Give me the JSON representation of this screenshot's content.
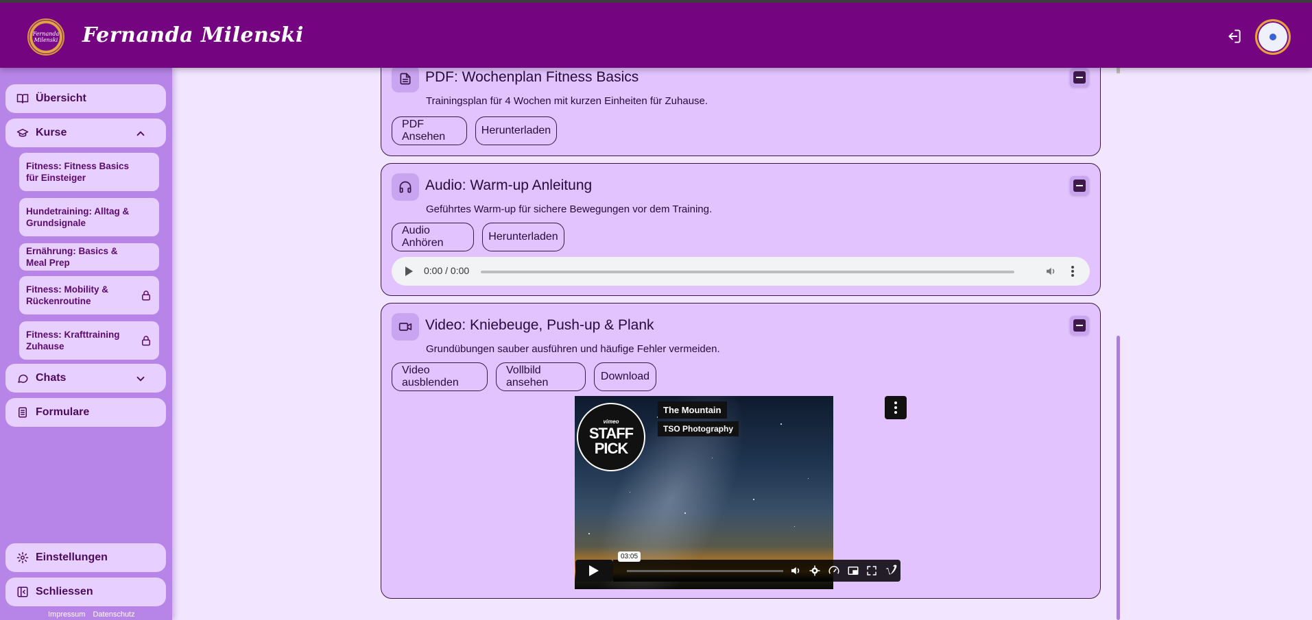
{
  "header": {
    "brand": "Fernanda Milenski",
    "logo_text": "Fernanda Milenski"
  },
  "sidebar": {
    "overview": "Übersicht",
    "courses": "Kurse",
    "course_items": [
      {
        "label": "Fitness: Fitness Basics für Einsteiger",
        "locked": false
      },
      {
        "label": "Hundetraining: Alltag & Grundsignale",
        "locked": false
      },
      {
        "label": "Ernährung: Basics & Meal Prep",
        "locked": false
      },
      {
        "label": "Fitness: Mobility & Rückenroutine",
        "locked": true
      },
      {
        "label": "Fitness: Krafttraining Zuhause",
        "locked": true
      }
    ],
    "chats": "Chats",
    "forms": "Formulare",
    "settings": "Einstellungen",
    "close": "Schliessen",
    "footer": {
      "imprint": "Impressum",
      "privacy": "Datenschutz"
    }
  },
  "cards": {
    "pdf": {
      "title": "PDF: Wochenplan Fitness Basics",
      "desc": "Trainingsplan für 4 Wochen mit kurzen Einheiten für Zuhause.",
      "btn_view": "PDF Ansehen",
      "btn_download": "Herunterladen"
    },
    "audio": {
      "title": "Audio: Warm-up Anleitung",
      "desc": "Geführtes Warm-up für sichere Bewegungen vor dem Training.",
      "btn_listen": "Audio Anhören",
      "btn_download": "Herunterladen",
      "time": "0:00 / 0:00"
    },
    "video": {
      "title": "Video: Kniebeuge, Push-up & Plank",
      "desc": "Grundübungen sauber ausführen und häufige Fehler vermeiden.",
      "btn_hide": "Video ausblenden",
      "btn_fullscreen": "Vollbild ansehen",
      "btn_download": "Download",
      "player": {
        "video_title": "The Mountain",
        "author": "TSO Photography",
        "badge_brand": "vimeo",
        "badge_line1": "STAFF",
        "badge_line2": "PICK",
        "time_tooltip": "03:05"
      }
    }
  }
}
